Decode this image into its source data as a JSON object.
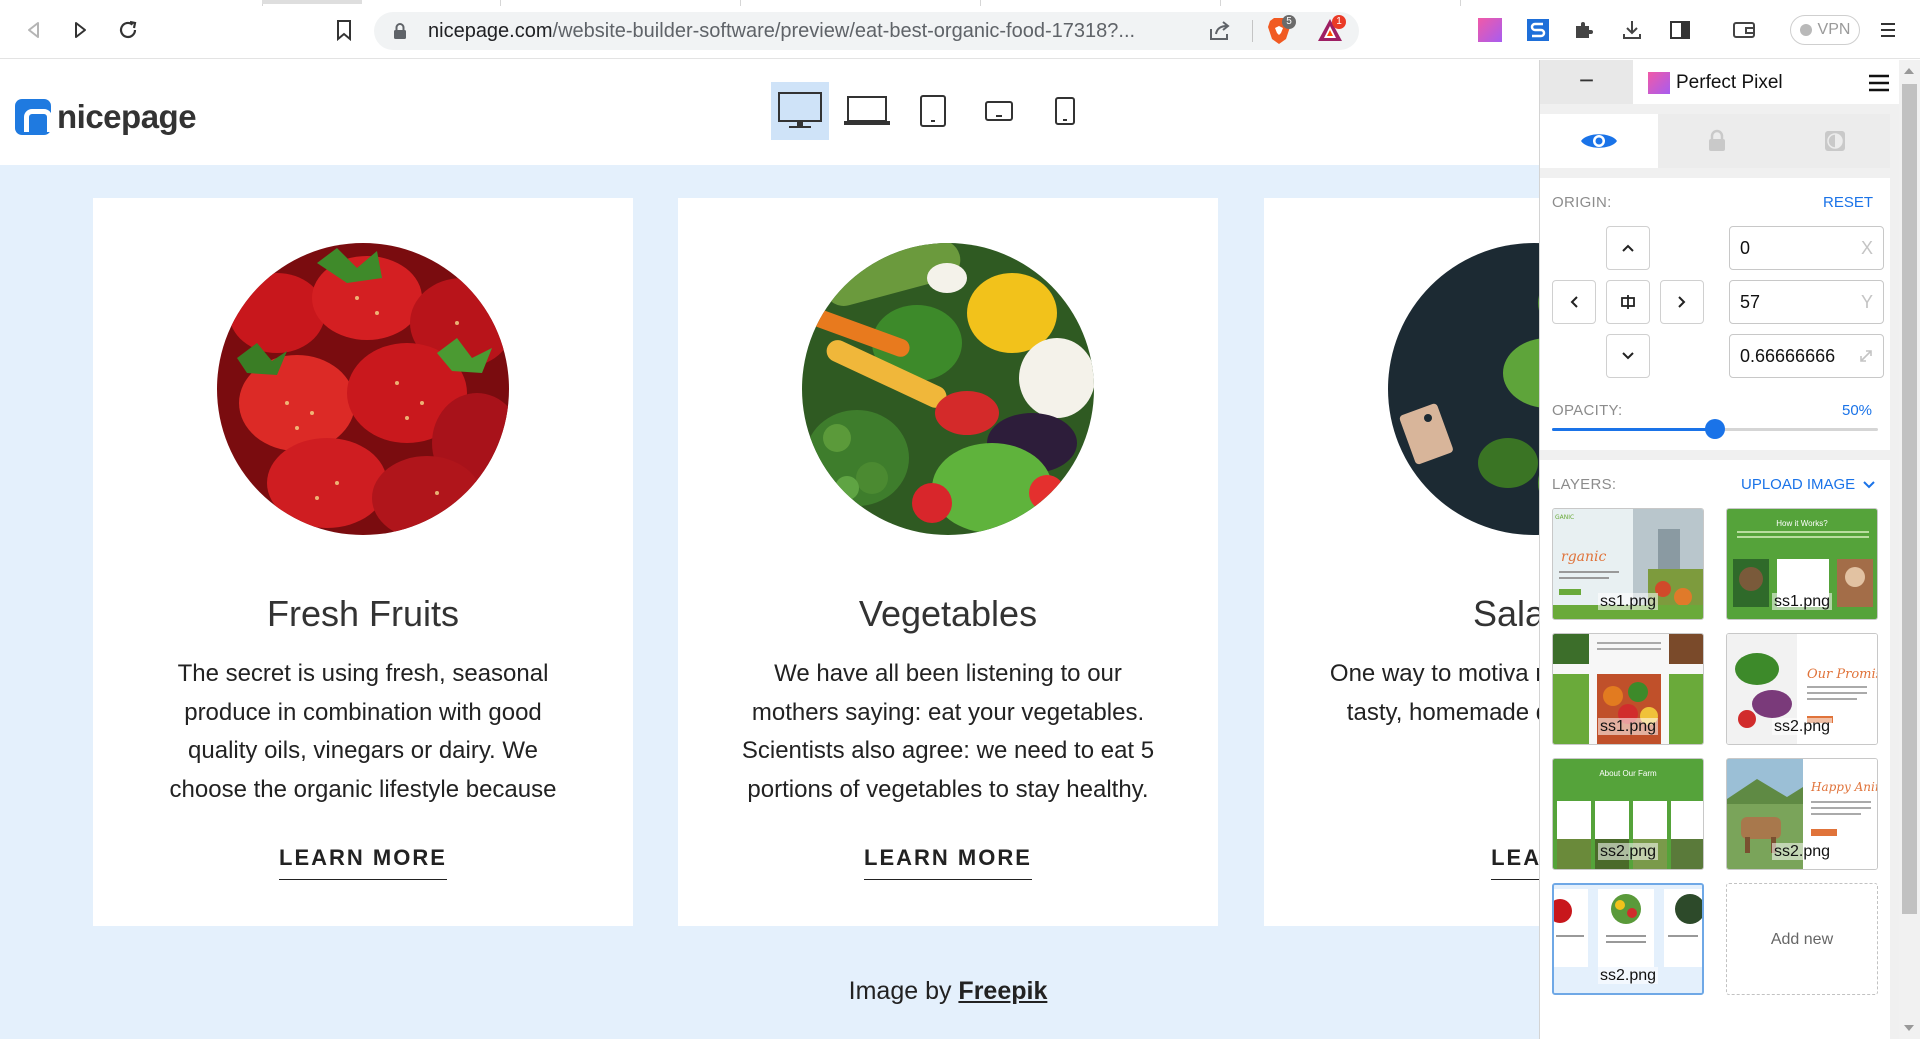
{
  "browser": {
    "url_host": "nicepage.com",
    "url_path": "/website-builder-software/preview/eat-best-organic-food-17318?...",
    "brave_badge": "5",
    "rewards_badge": "1",
    "vpn_label": "VPN"
  },
  "header": {
    "logo_text": "nicepage",
    "devices": [
      "desktop",
      "laptop",
      "tablet",
      "tablet-landscape",
      "phone"
    ],
    "active_device": "desktop"
  },
  "cards": [
    {
      "title": "Fresh Fruits",
      "text": "The secret is using fresh, seasonal produce in combination with good quality oils, vinegars or dairy. We choose the organic lifestyle because",
      "link": "LEARN MORE"
    },
    {
      "title": "Vegetables",
      "text": "We have all been listening to our mothers saying: eat your vegetables. Scientists also agree: we need to eat 5 portions of vegetables to stay healthy.",
      "link": "LEARN MORE"
    },
    {
      "title": "Salad L",
      "text": "One way to motiva more salad this sur tasty, homemade dr top. Organic fo",
      "link": "LEARN"
    }
  ],
  "credit": {
    "prefix": "Image by ",
    "link": "Freepik"
  },
  "panel": {
    "minimize": "−",
    "title": "Perfect Pixel",
    "origin_label": "ORIGIN:",
    "reset_label": "RESET",
    "x_value": "0",
    "x_unit": "X",
    "y_value": "57",
    "y_unit": "Y",
    "scale_value": "0.66666666",
    "opacity_label": "OPACITY:",
    "opacity_value": "50%",
    "opacity_fraction": 0.5,
    "layers_label": "LAYERS:",
    "upload_label": "UPLOAD IMAGE",
    "layers": [
      {
        "name": "ss1.png",
        "selected": false
      },
      {
        "name": "ss1.png",
        "selected": false
      },
      {
        "name": "ss1.png",
        "selected": false
      },
      {
        "name": "ss2.png",
        "selected": false
      },
      {
        "name": "ss2.png",
        "selected": false
      },
      {
        "name": "ss2.png",
        "selected": false
      },
      {
        "name": "ss2.png",
        "selected": true
      }
    ],
    "add_new_label": "Add new"
  },
  "colors": {
    "accent": "#1a73e8",
    "page_bg": "#e4f0fc",
    "brand_green": "#55a33a",
    "nicepage_blue": "#1f7ae0"
  }
}
